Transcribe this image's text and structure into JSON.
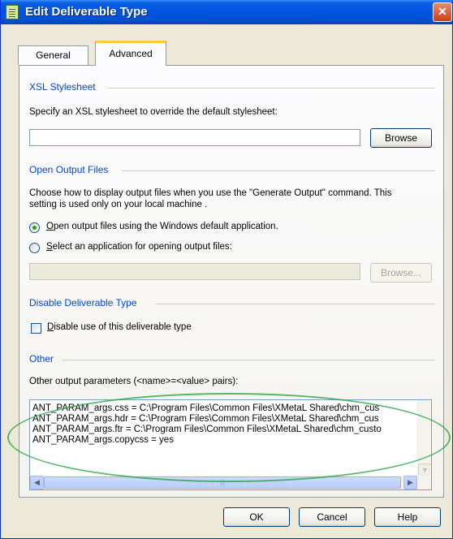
{
  "window": {
    "title": "Edit Deliverable Type",
    "close_glyph": "✕"
  },
  "tabs": [
    {
      "label": "General",
      "active": false
    },
    {
      "label": "Advanced",
      "active": true
    }
  ],
  "xsl": {
    "section": "XSL Stylesheet",
    "description": "Specify an XSL stylesheet to override the default stylesheet:",
    "value": "",
    "browse_label": "Browse"
  },
  "output": {
    "section": "Open Output Files",
    "description_line1": "Choose how to display output files when you use the \"Generate Output\" command. This",
    "description_line2": "setting is used only on your local machine .",
    "option_default_mnemonic": "O",
    "option_default_rest": "pen output files using the Windows default application.",
    "option_select_mnemonic": "S",
    "option_select_rest": "elect an application for opening output files:",
    "selected": "default",
    "app_value": "",
    "browse_label": "Browse..."
  },
  "disable": {
    "section": "Disable Deliverable Type",
    "checkbox_mnemonic": "D",
    "checkbox_rest": "isable use of this deliverable type",
    "checked": false
  },
  "other": {
    "section": "Other",
    "params_label": "Other output parameters (<name>=<value> pairs):",
    "lines": [
      "ANT_PARAM_args.css = C:\\Program Files\\Common Files\\XMetaL Shared\\chm_cus",
      "ANT_PARAM_args.hdr = C:\\Program Files\\Common Files\\XMetaL Shared\\chm_cus",
      "ANT_PARAM_args.ftr = C:\\Program Files\\Common Files\\XMetaL Shared\\chm_custo",
      "ANT_PARAM_args.copycss = yes"
    ]
  },
  "buttons": {
    "ok": "OK",
    "cancel": "Cancel",
    "help": "Help"
  },
  "colors": {
    "titlebar": "#0054e3",
    "section_label": "#0046d5",
    "annotation_ellipse": "#2ea84a"
  }
}
